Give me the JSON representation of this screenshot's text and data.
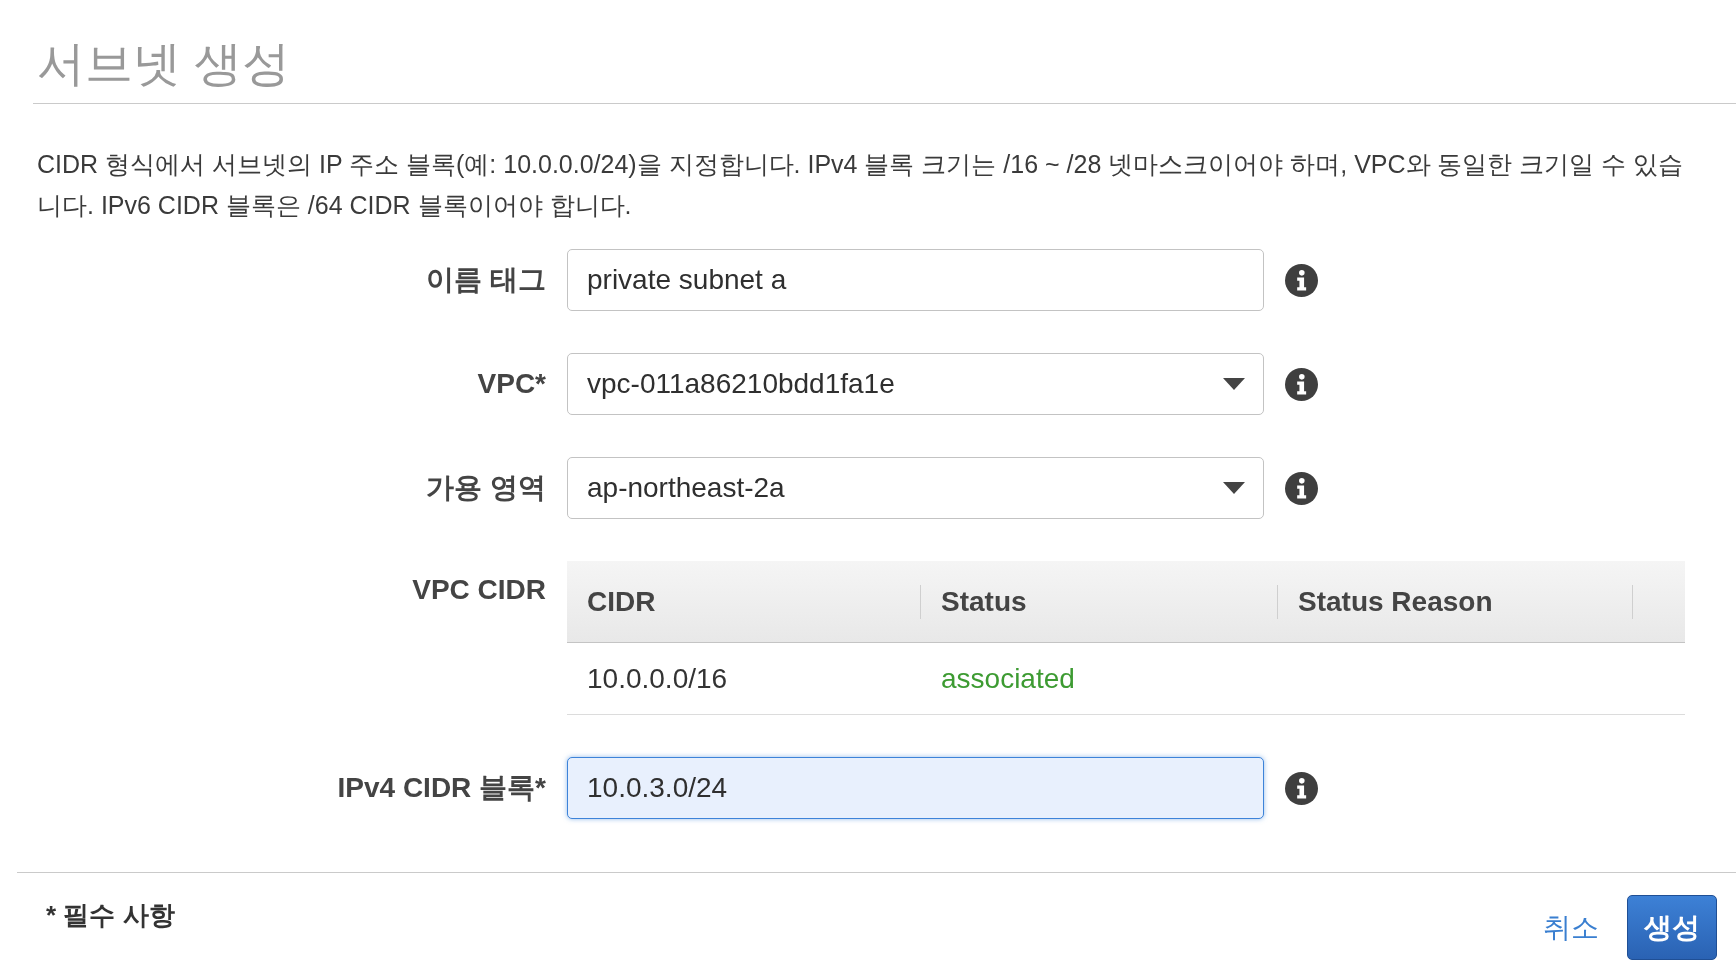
{
  "page": {
    "title": "서브넷 생성",
    "description": "CIDR 형식에서 서브넷의 IP 주소 블록(예: 10.0.0.0/24)을 지정합니다. IPv4 블록 크기는 /16 ~ /28 넷마스크이어야 하며, VPC와 동일한 크기일 수 있습니다. IPv6 CIDR 블록은 /64 CIDR 블록이어야 합니다."
  },
  "form": {
    "rows": [
      {
        "kind": "text",
        "label": "이름 태그",
        "value": "private subnet a",
        "focused": false
      },
      {
        "kind": "select",
        "label": "VPC*",
        "value": "vpc-011a86210bdd1fa1e",
        "focused": false
      },
      {
        "kind": "select",
        "label": "가용 영역",
        "value": "ap-northeast-2a",
        "focused": false
      },
      {
        "kind": "table",
        "label": "VPC CIDR",
        "columns": [
          "CIDR",
          "Status",
          "Status Reason"
        ],
        "rows": [
          {
            "cidr": "10.0.0.0/16",
            "status": "associated",
            "color": "#3d9b32"
          }
        ]
      },
      {
        "kind": "text",
        "label": "IPv4 CIDR 블록*",
        "value": "10.0.3.0/24",
        "focused": true
      }
    ]
  },
  "footer": {
    "note": "* 필수 사항",
    "cancel": "취소",
    "submit": "생성"
  }
}
